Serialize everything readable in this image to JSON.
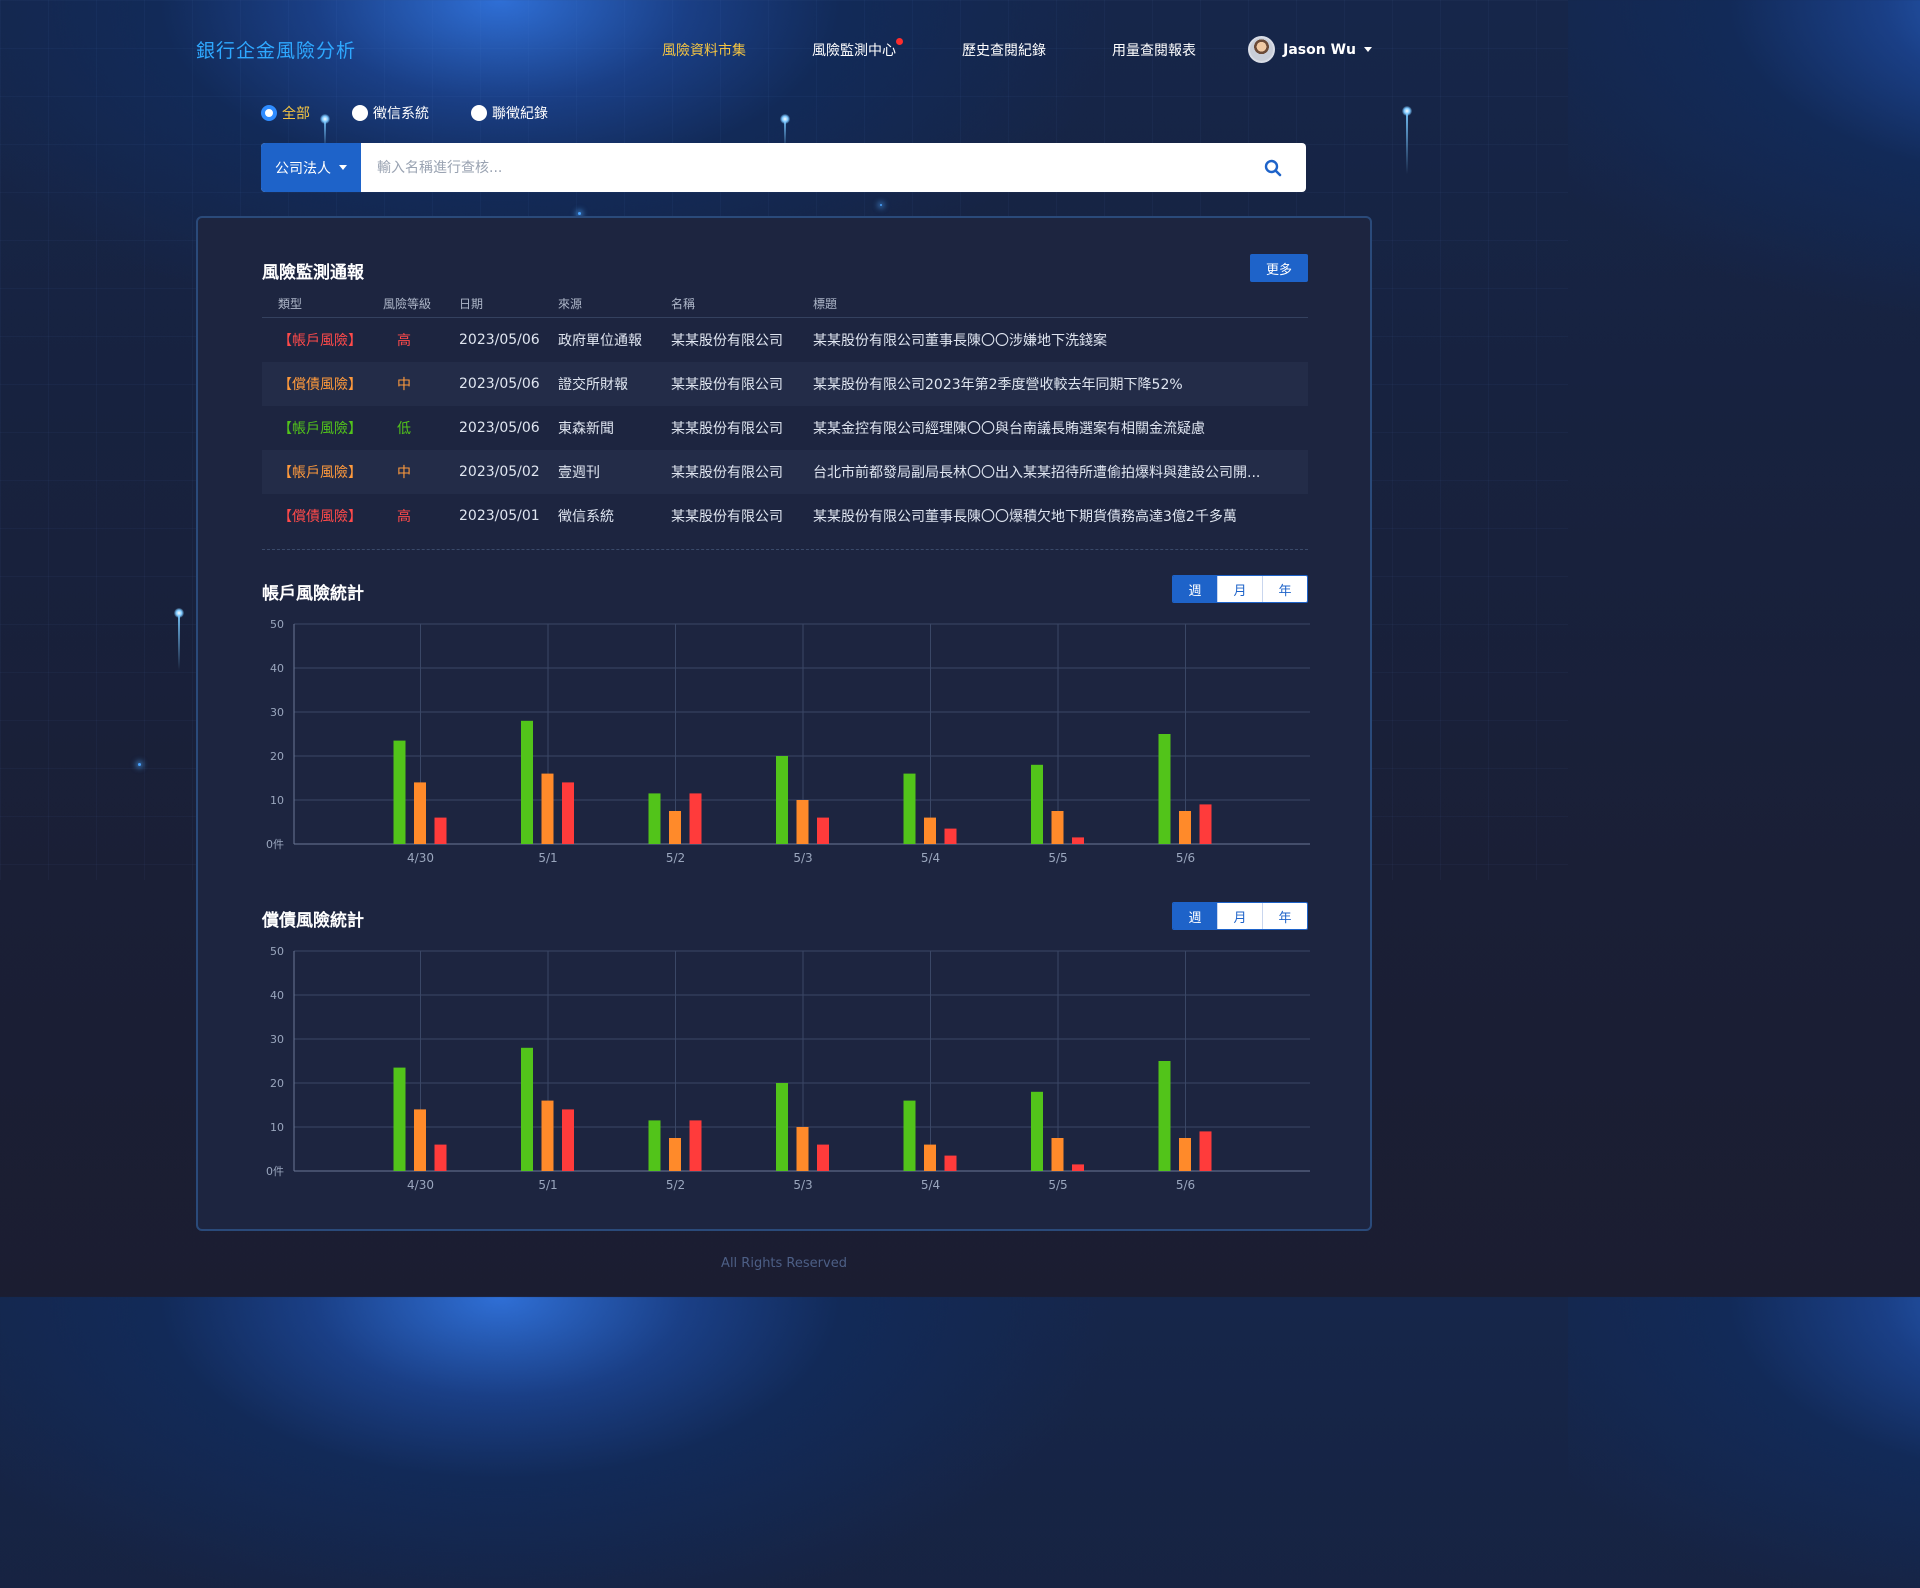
{
  "brand": "銀行企金風險分析",
  "nav": {
    "items": [
      "風險資料市集",
      "風險監測中心",
      "歷史查閱紀錄",
      "用量查閱報表"
    ],
    "active_index": 0,
    "notification_index": 1
  },
  "user": {
    "name": "Jason Wu"
  },
  "filters": {
    "options": [
      "全部",
      "徵信系統",
      "聯徵紀錄"
    ],
    "selected": "全部"
  },
  "search": {
    "type_label": "公司法人",
    "placeholder": "輸入名稱進行查核..."
  },
  "alerts": {
    "title": "風險監測通報",
    "more_label": "更多",
    "columns": [
      "類型",
      "風險等級",
      "日期",
      "來源",
      "名稱",
      "標題"
    ],
    "rows": [
      {
        "type": "【帳戶風險】",
        "level": "高",
        "date": "2023/05/06",
        "source": "政府單位通報",
        "name": "某某股份有限公司",
        "title": "某某股份有限公司董事長陳〇〇涉嫌地下洗錢案"
      },
      {
        "type": "【償債風險】",
        "level": "中",
        "date": "2023/05/06",
        "source": "證交所財報",
        "name": "某某股份有限公司",
        "title": "某某股份有限公司2023年第2季度營收較去年同期下降52%"
      },
      {
        "type": "【帳戶風險】",
        "level": "低",
        "date": "2023/05/06",
        "source": "東森新聞",
        "name": "某某股份有限公司",
        "title": "某某金控有限公司經理陳〇〇與台南議長賄選案有相關金流疑慮"
      },
      {
        "type": "【帳戶風險】",
        "level": "中",
        "date": "2023/05/02",
        "source": "壹週刊",
        "name": "某某股份有限公司",
        "title": "台北市前都發局副局長林〇〇出入某某招待所遭偷拍爆料與建設公司開..."
      },
      {
        "type": "【償債風險】",
        "level": "高",
        "date": "2023/05/01",
        "source": "徵信系統",
        "name": "某某股份有限公司",
        "title": "某某股份有限公司董事長陳〇〇爆積欠地下期貨債務高達3億2千多萬"
      }
    ]
  },
  "level_colors": {
    "高": "#ff4a4a",
    "中": "#ff9a3c",
    "低": "#52c41a"
  },
  "period_tabs": [
    "週",
    "月",
    "年"
  ],
  "active_period": "週",
  "sections": {
    "account_title": "帳戶風險統計",
    "debt_title": "償債風險統計"
  },
  "chart_data": [
    {
      "type": "bar",
      "title": "帳戶風險統計",
      "categories": [
        "4/30",
        "5/1",
        "5/2",
        "5/3",
        "5/4",
        "5/5",
        "5/6"
      ],
      "ylim": [
        0,
        50
      ],
      "yticks": [
        "0件",
        "10",
        "20",
        "30",
        "40",
        "50"
      ],
      "colors": [
        "#52c41a",
        "#ff8a2a",
        "#ff3b3b"
      ],
      "series": [
        {
          "values": [
            23.5,
            28,
            11.5,
            20,
            16,
            18,
            25
          ]
        },
        {
          "values": [
            14,
            16,
            7.5,
            10,
            6,
            7.5,
            7.5
          ]
        },
        {
          "values": [
            6,
            14,
            11.5,
            6,
            3.5,
            1.5,
            9
          ]
        }
      ]
    },
    {
      "type": "bar",
      "title": "償債風險統計",
      "categories": [
        "4/30",
        "5/1",
        "5/2",
        "5/3",
        "5/4",
        "5/5",
        "5/6"
      ],
      "ylim": [
        0,
        50
      ],
      "yticks": [
        "0件",
        "10",
        "20",
        "30",
        "40",
        "50"
      ],
      "colors": [
        "#52c41a",
        "#ff8a2a",
        "#ff3b3b"
      ],
      "series": [
        {
          "values": [
            23.5,
            28,
            11.5,
            20,
            16,
            18,
            25
          ]
        },
        {
          "values": [
            14,
            16,
            7.5,
            10,
            6,
            7.5,
            7.5
          ]
        },
        {
          "values": [
            6,
            14,
            11.5,
            6,
            3.5,
            1.5,
            9
          ]
        }
      ]
    }
  ],
  "footer": "All Rights Reserved"
}
